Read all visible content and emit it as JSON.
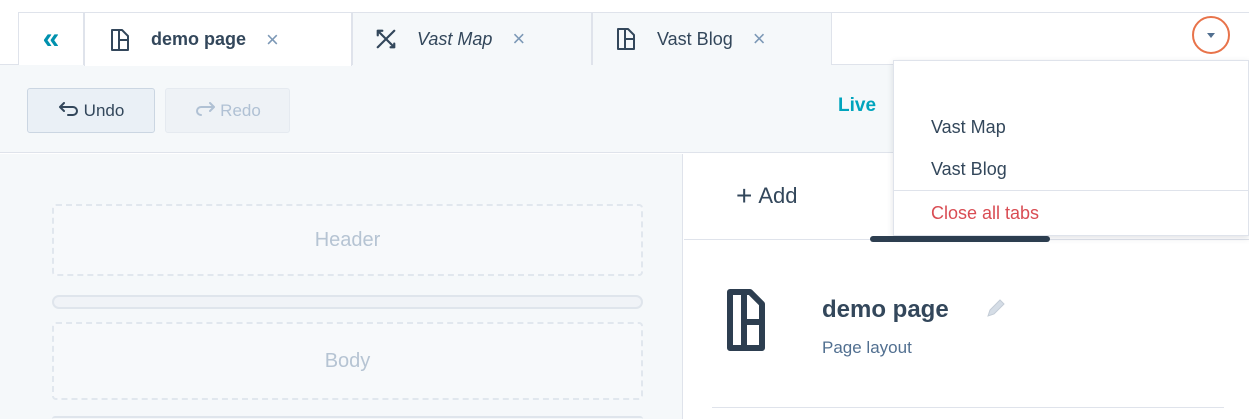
{
  "tabbar": {
    "collapse_glyph": "«",
    "tabs": [
      {
        "label": "demo page",
        "icon": "page-icon",
        "active": true
      },
      {
        "label": "Vast Map",
        "icon": "tools-icon",
        "active": false
      },
      {
        "label": "Vast Blog",
        "icon": "page-icon",
        "active": false
      }
    ],
    "close_glyph": "×",
    "dropdown_icon": "chevron-down-icon"
  },
  "toolbar": {
    "undo_label": "Undo",
    "redo_label": "Redo",
    "undo_icon": "undo-arrow-icon",
    "redo_icon": "redo-arrow-icon",
    "live_label": "Live"
  },
  "canvas": {
    "header_label": "Header",
    "body_label": "Body"
  },
  "sidebar": {
    "add_label": "Add",
    "add_glyph": "+",
    "page_name": "demo page",
    "page_subtitle": "Page layout"
  },
  "dropdown_menu": {
    "items": [
      "Vast Map",
      "Vast Blog"
    ],
    "close_all_label": "Close all tabs"
  },
  "colors": {
    "accent": "#0091ae",
    "live": "#00a4bd",
    "highlight_ring": "#e8734a",
    "danger": "#d94c53",
    "text": "#33475b",
    "canvas_bg": "#f5f8fa"
  }
}
